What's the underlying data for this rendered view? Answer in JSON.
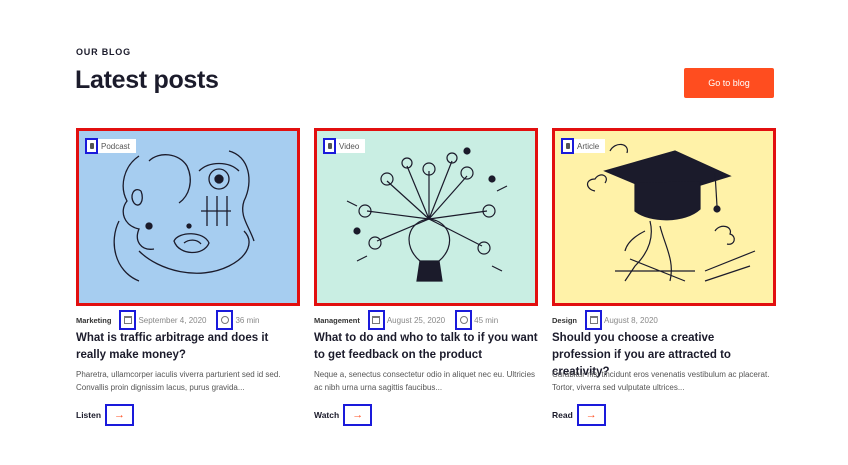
{
  "header": {
    "eyebrow": "OUR BLOG",
    "title": "Latest posts",
    "cta_label": "Go to blog"
  },
  "colors": {
    "accent": "#ff4d1f",
    "card1_bg": "#a6cdf0",
    "card2_bg": "#c9eee3",
    "card3_bg": "#fff2a8",
    "highlight_red": "#e20f0f",
    "highlight_blue": "#1a1adb"
  },
  "posts": [
    {
      "type": "Podcast",
      "type_icon": "microphone-icon",
      "category": "Marketing",
      "date": "September 4, 2020",
      "duration": "36 min",
      "title": "What is traffic arbitrage and does it really make money?",
      "excerpt": "Pharetra, ullamcorper iaculis viverra parturient sed id sed. Convallis proin dignissim lacus, purus gravida...",
      "action": "Listen"
    },
    {
      "type": "Video",
      "type_icon": "video-icon",
      "category": "Management",
      "date": "August 25, 2020",
      "duration": "45 min",
      "title": "What to do and who to talk to if you want to get feedback on the product",
      "excerpt": "Neque a, senectus consectetur odio in aliquet nec eu. Ultricies ac nibh urna urna sagittis faucibus...",
      "action": "Watch"
    },
    {
      "type": "Article",
      "type_icon": "file-icon",
      "category": "Design",
      "date": "August 8, 2020",
      "title": "Should you choose a creative profession if you are attracted to creativity?",
      "excerpt": "Curabitur nisi tincidunt eros venenatis vestibulum ac placerat. Tortor, viverra sed vulputate ultrices...",
      "action": "Read"
    }
  ]
}
